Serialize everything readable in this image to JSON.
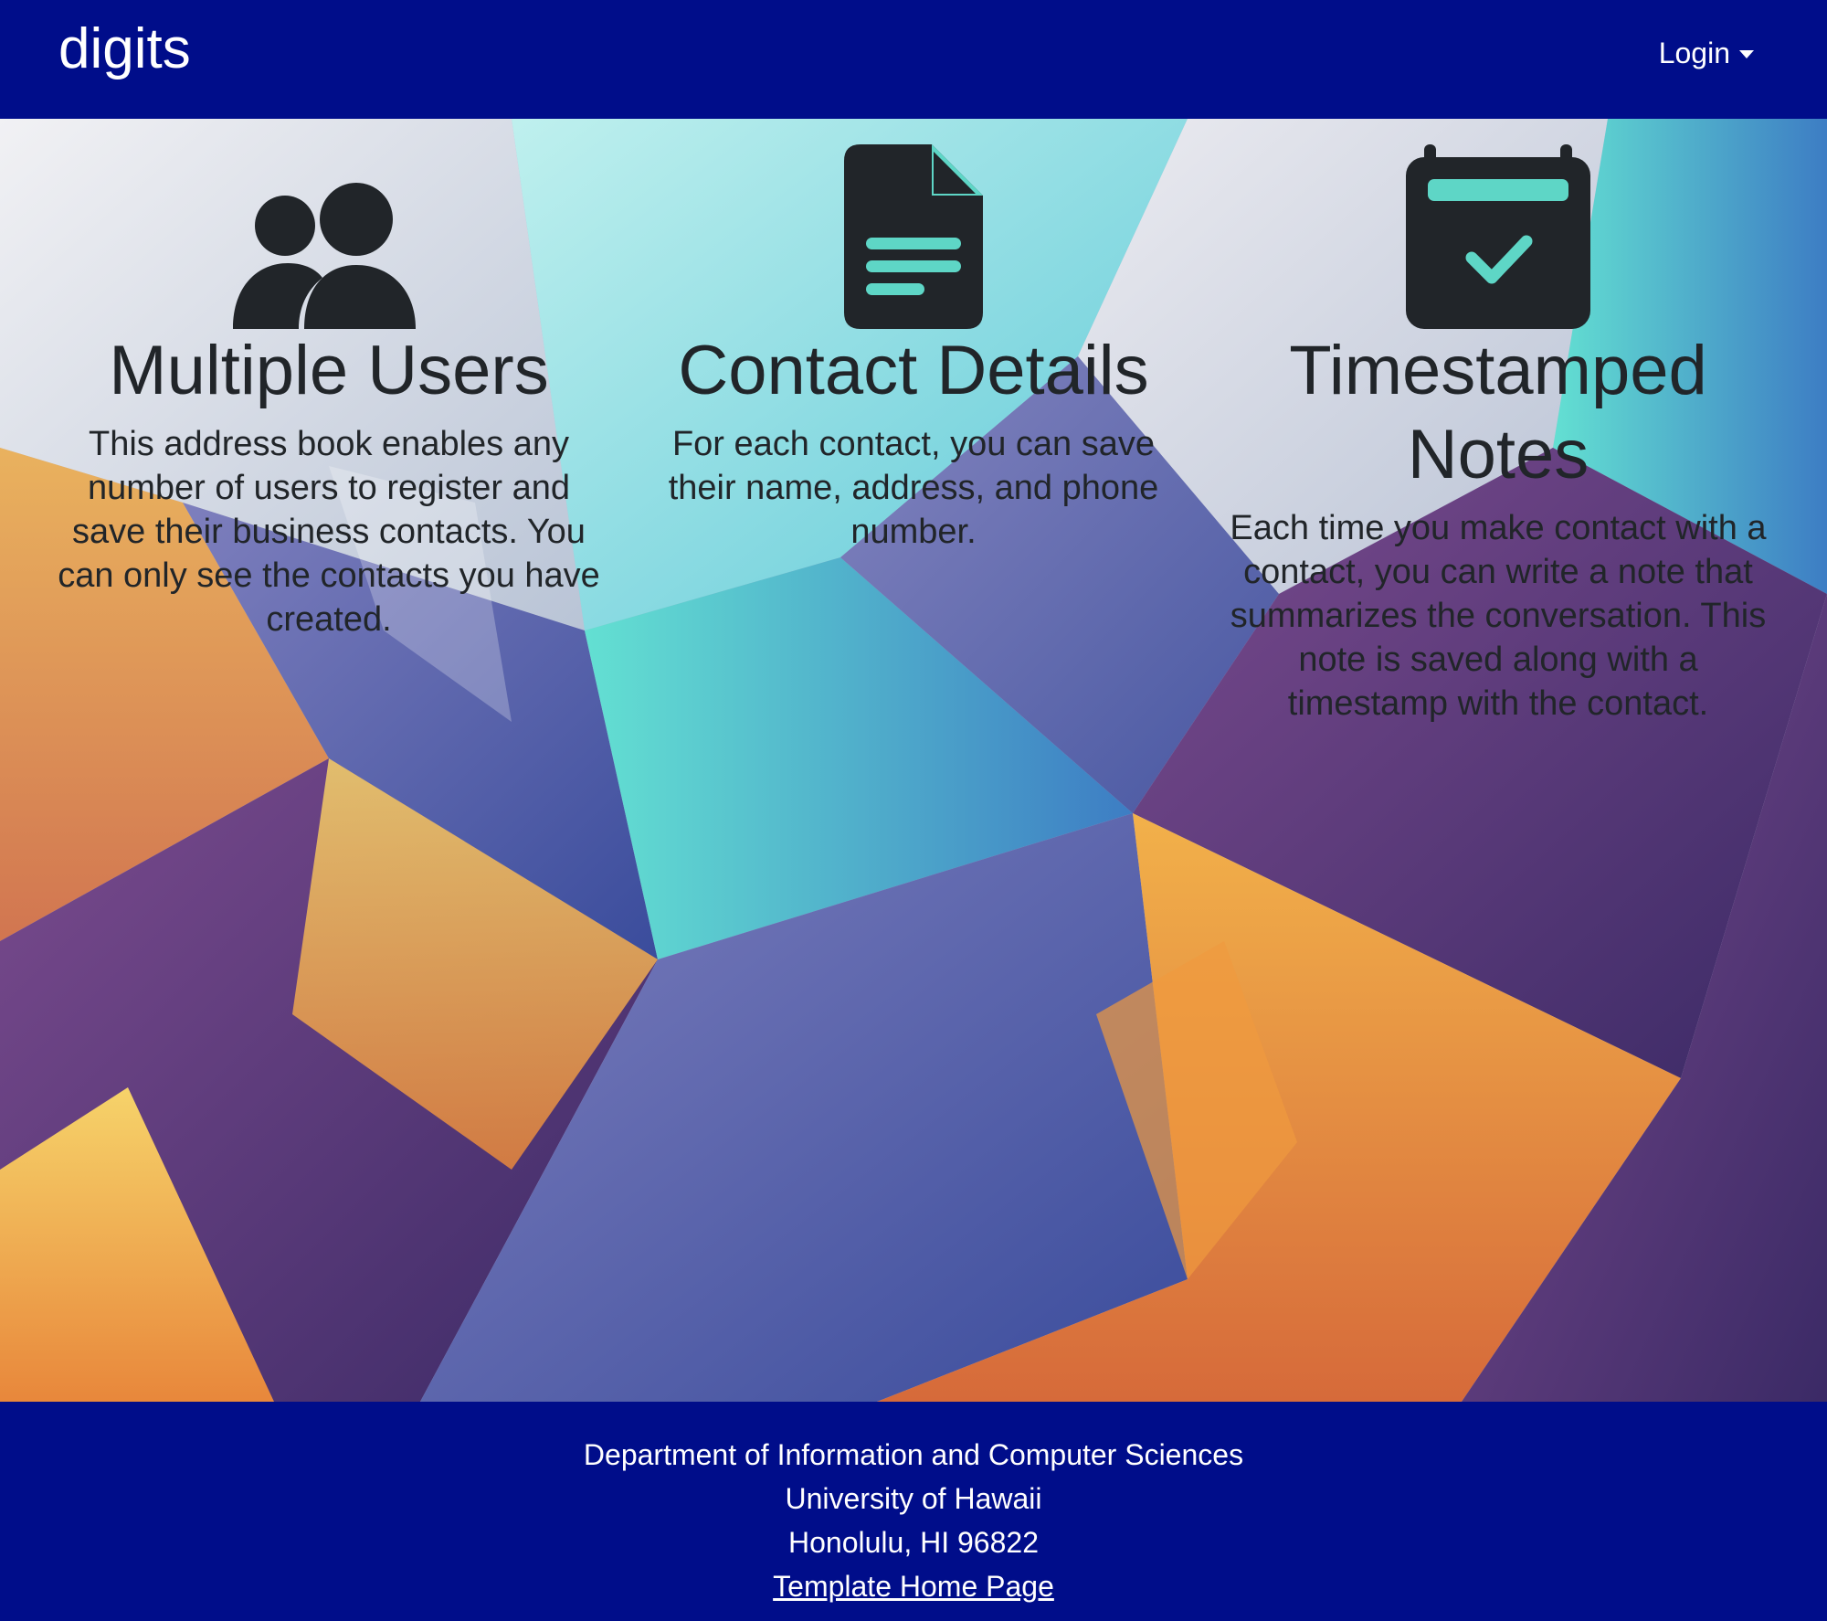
{
  "navbar": {
    "brand": "digits",
    "login_label": "Login"
  },
  "features": [
    {
      "icon": "users-icon",
      "title": "Multiple Users",
      "text": "This address book enables any number of users to register and save their business contacts. You can only see the contacts you have created."
    },
    {
      "icon": "file-text-icon",
      "title": "Contact Details",
      "text": "For each contact, you can save their name, address, and phone number."
    },
    {
      "icon": "calendar-check-icon",
      "title": "Timestamped Notes",
      "text": "Each time you make contact with a contact, you can write a note that summarizes the conversation. This note is saved along with a timestamp with the contact."
    }
  ],
  "footer": {
    "line1": "Department of Information and Computer Sciences",
    "line2": "University of Hawaii",
    "line3": "Honolulu, HI 96822",
    "link": "Template Home Page"
  },
  "colors": {
    "navbar_bg": "#000d8a",
    "text_dark": "#212529",
    "icon_accent": "#5ed6c6"
  }
}
